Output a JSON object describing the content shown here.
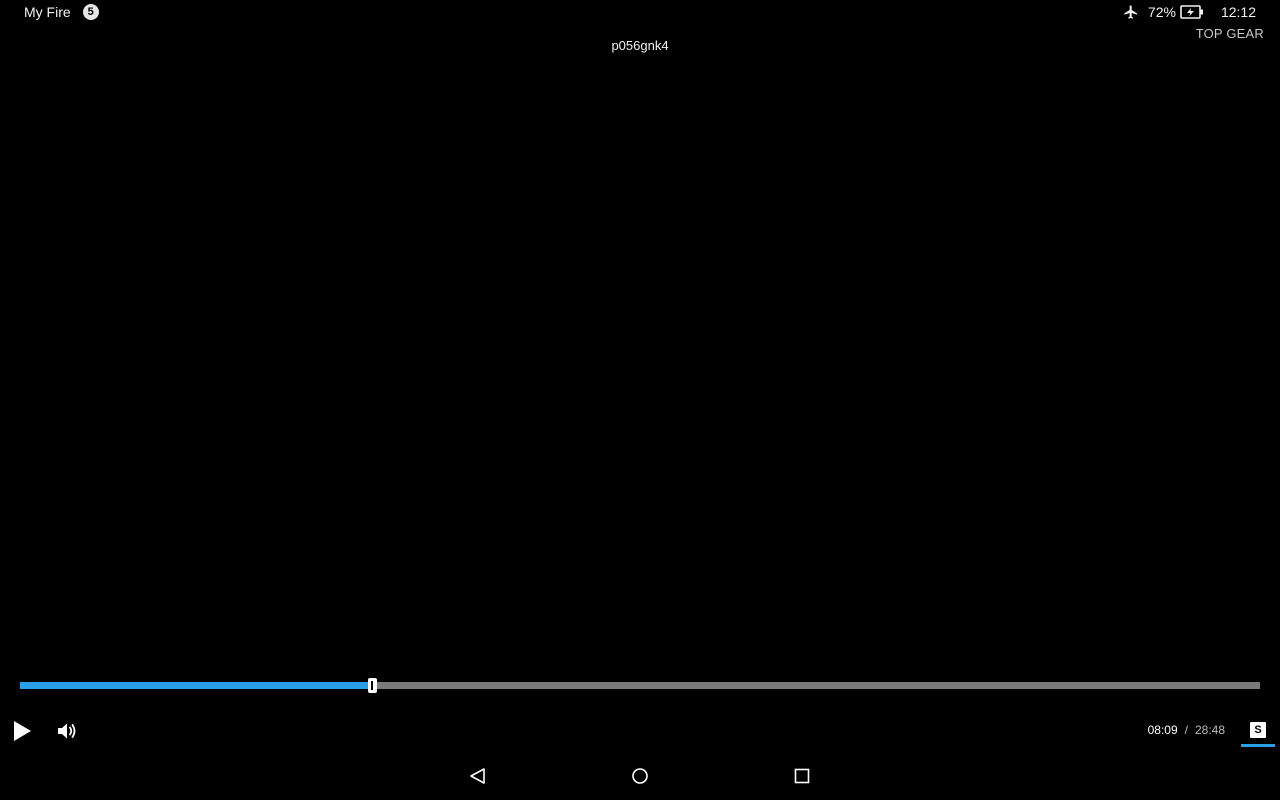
{
  "status_bar": {
    "app_name": "My Fire",
    "notification_count": "5",
    "battery_percent": "72%",
    "time": "12:12",
    "icons": [
      "airplane-icon",
      "battery-charging-icon"
    ]
  },
  "player": {
    "video_title": "p056gnk4",
    "program_name": "TOP GEAR",
    "current_time": "08:09",
    "time_separator": "/",
    "duration": "28:48",
    "progress_fraction": 0.284,
    "subtitle_label": "S",
    "accent_color": "#2a9fe8",
    "icons": [
      "play-icon",
      "volume-icon",
      "subtitles-icon"
    ]
  },
  "nav_bar": {
    "icons": [
      "back-icon",
      "home-icon",
      "recents-icon"
    ]
  }
}
